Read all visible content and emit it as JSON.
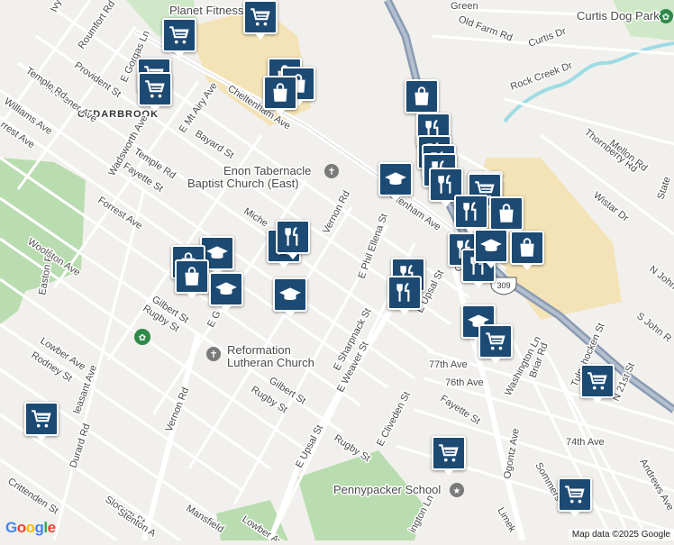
{
  "map": {
    "area_labels": {
      "cedarbrook": "CEDARBROOK"
    },
    "places": {
      "planet_fitness": "Planet Fitness",
      "curtis_dog_park": "Curtis Dog Park",
      "enon_line1": "Enon Tabernacle",
      "enon_line2": "Baptist Church (East)",
      "reformation_line1": "Reformation",
      "reformation_line2": "Lutheran Church",
      "pennypacker": "Pennypacker School"
    },
    "streets": {
      "ivy": "Ivy Hi",
      "roumfort": "Roumfort Rd",
      "provident": "Provident St",
      "e_gorgas": "E Gorgas Ln",
      "michener": "Michener Ave",
      "temple_nw": "Temple Rd",
      "williams_w": "Williams Ave",
      "forrest_w": "rrest Ave",
      "wadsworth": "Wadsworth Ave",
      "cheltenham_w": "Cheltenham Ave",
      "mt_airy": "E Mt Airy Ave",
      "bayard": "Bayard St",
      "temple": "Temple Rd",
      "fayette_w": "Fayette St",
      "forrest": "Forrest Ave",
      "easton": "Easton Rd",
      "woolston": "Woolston Ave",
      "michener_2": "Miche",
      "vernon_n": "Vernon Rd",
      "cheltenham_e": "Cheltenham Ave",
      "e_phil_ellena": "E Phil Ellena St",
      "e_upsal_n": "E Upsal St",
      "ogontz_n": "Ogontz",
      "gilbert": "Gilbert St",
      "e_gorgas_2": "E G",
      "rugby": "Rugby St",
      "lowber": "Lowber Ave",
      "rodney": "Rodney St",
      "pleasant": "leasant Ave",
      "vernon_s": "Vernon Rd",
      "e_sharpnack": "E Sharpnack St",
      "e_weaver": "E Weaver St",
      "gilbert_s": "Gilbert St",
      "rugby_s": "Rugby St",
      "e_cliveden": "E Cliveden St",
      "e_upsal_s": "E Upsal St",
      "rugby_s2": "Rugby St",
      "durard": "Durard Rd",
      "crittenden": "Crittenden St",
      "slocum": "Slocum St",
      "stenton": "Stenton A",
      "mansfield": "Mansfield",
      "lowber_s": "Lowber Ave",
      "washington_n": "Washington Ln",
      "washington_s": "ington Ln",
      "th77": "77th Ave",
      "th76": "76th Ave",
      "fayette_e": "Fayette St",
      "ogontz_s": "Ogontz Ave",
      "th74": "74th Ave",
      "briar": "Briar Rd",
      "tulpehocken": "Tulpehocken St",
      "st21": "N 21st St",
      "sommers": "Sommers",
      "andrews": "Andrews Ave",
      "limek": "Limek",
      "green": "Green",
      "old_farm": "Old Farm Rd",
      "curtis_dr": "Curtis Dr",
      "rock_creek": "Rock Creek Dr",
      "thornberry": "Thornberry Rd",
      "mellon": "Mellon Rd",
      "wistar": "Wistar Dr",
      "state": "State",
      "n_john": "N John",
      "s_john": "S John R",
      "wo": "Wo",
      "lan": "lan St",
      "rc": "Ro",
      "apple": "apple Rd",
      "e_temple_rd": "ple Rd",
      "e_weaver_st2": "ve St",
      "rd_bot": "Rd",
      "wil_ave": "Williams Ave"
    },
    "route_shield": "309",
    "google_logo": "Google",
    "attribution": "Map data ©2025 Google",
    "colors": {
      "marker": "#1c4a73",
      "park": "#b9ddb0",
      "commercial": "#f3e3b7",
      "water": "#9ddce4",
      "highway": "#8a9bb3"
    },
    "markers": [
      {
        "icon": "cart",
        "name": "store-marker"
      },
      {
        "icon": "cart",
        "name": "store-marker"
      },
      {
        "icon": "cart",
        "name": "store-marker"
      },
      {
        "icon": "cart",
        "name": "store-marker"
      },
      {
        "icon": "bag",
        "name": "shop-marker"
      },
      {
        "icon": "bag",
        "name": "shop-marker"
      },
      {
        "icon": "bag",
        "name": "shop-marker"
      },
      {
        "icon": "bag",
        "name": "shop-marker"
      },
      {
        "icon": "fork",
        "name": "restaurant-marker"
      },
      {
        "icon": "fork",
        "name": "restaurant-marker"
      },
      {
        "icon": "fork",
        "name": "restaurant-marker"
      },
      {
        "icon": "fork",
        "name": "restaurant-marker"
      },
      {
        "icon": "fork",
        "name": "restaurant-marker"
      },
      {
        "icon": "cap",
        "name": "school-marker"
      },
      {
        "icon": "fork",
        "name": "restaurant-marker"
      },
      {
        "icon": "cart",
        "name": "store-marker"
      },
      {
        "icon": "fork",
        "name": "restaurant-marker"
      },
      {
        "icon": "bag",
        "name": "shop-marker"
      },
      {
        "icon": "fork",
        "name": "restaurant-marker"
      },
      {
        "icon": "fork",
        "name": "restaurant-marker"
      },
      {
        "icon": "cap",
        "name": "school-marker"
      },
      {
        "icon": "bag",
        "name": "shop-marker"
      },
      {
        "icon": "fork",
        "name": "restaurant-marker"
      },
      {
        "icon": "fork",
        "name": "restaurant-marker"
      },
      {
        "icon": "fork",
        "name": "restaurant-marker"
      },
      {
        "icon": "fork",
        "name": "restaurant-marker"
      },
      {
        "icon": "cap",
        "name": "school-marker"
      },
      {
        "icon": "bag",
        "name": "shop-marker"
      },
      {
        "icon": "bag",
        "name": "shop-marker"
      },
      {
        "icon": "cap",
        "name": "school-marker"
      },
      {
        "icon": "cap",
        "name": "school-marker"
      },
      {
        "icon": "cap",
        "name": "school-marker"
      },
      {
        "icon": "cart",
        "name": "store-marker"
      },
      {
        "icon": "cart",
        "name": "store-marker"
      },
      {
        "icon": "cart",
        "name": "store-marker"
      },
      {
        "icon": "cart",
        "name": "store-marker"
      },
      {
        "icon": "cart",
        "name": "store-marker"
      }
    ]
  }
}
